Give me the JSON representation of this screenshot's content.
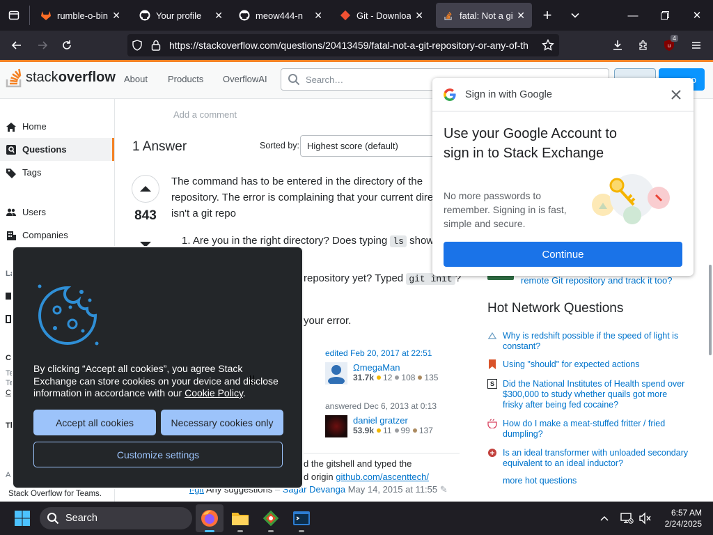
{
  "browser": {
    "tabs": [
      {
        "label": "rumble-o-bin · G",
        "icon": "gitlab-icon"
      },
      {
        "label": "Your profile",
        "icon": "github-icon"
      },
      {
        "label": "meow444-n",
        "icon": "github-icon"
      },
      {
        "label": "Git - Downloadin",
        "icon": "git-icon"
      },
      {
        "label": "fatal: Not a git re",
        "icon": "stackoverflow-icon",
        "active": true
      }
    ],
    "url": "https://stackoverflow.com/questions/20413459/fatal-not-a-git-repository-or-any-of-th",
    "extension_badge": "4"
  },
  "so_header": {
    "logo_prefix": "stack",
    "logo_bold": "overflow",
    "nav": [
      "About",
      "Products",
      "OverflowAI"
    ],
    "search_placeholder": "Search…",
    "signup_label": "p"
  },
  "sidebar": {
    "items": [
      {
        "label": "Home",
        "icon": "home-icon"
      },
      {
        "label": "Questions",
        "icon": "questions-icon",
        "selected": true
      },
      {
        "label": "Tags",
        "icon": "tag-icon"
      },
      {
        "label": "Users",
        "icon": "users-icon"
      },
      {
        "label": "Companies",
        "icon": "companies-icon"
      }
    ],
    "partial_letters": [
      "La",
      "C",
      "Te",
      "Te",
      "C",
      "Th",
      "A"
    ],
    "footer": "Stack Overflow for Teams."
  },
  "main": {
    "add_comment": "Add a comment",
    "answers_count": "1 Answer",
    "sorted_by_label": "Sorted by:",
    "sort_value": "Highest score (default)",
    "vote_score": "843",
    "answer_line1": "The command has to be entered in the directory of the",
    "answer_line2": "repository. The error is complaining that your current dire",
    "answer_line3": "isn't a git repo",
    "list1_prefix": "1. Are you in the right directory? Does typing ",
    "list1_code": "ls",
    "list1_suffix": " show",
    "list2_prefix": "repository yet? Typed ",
    "list2_code": "git init",
    "list2_suffix": "?",
    "list3": "your error.",
    "edited": {
      "label": "edited Feb 20, 2017 at 22:51",
      "name": "ΩmegaMan",
      "rep": "31.7k",
      "gold": "12",
      "silver": "108",
      "bronze": "135"
    },
    "answered": {
      "label": "answered Dec 6, 2013 at 0:13",
      "name": "daniel gratzer",
      "rep": "53.9k",
      "gold": "11",
      "silver": "99",
      "bronze": "137"
    },
    "comment_l1": "d the gitshell and typed the",
    "comment_l2_prefix": "d origin ",
    "comment_link": "github.com/ascenttech/",
    "comment_l3_prefix": "Any suggestions",
    "comment_l3_tag": "i-git",
    "comment_user": "Sagar Devanga",
    "comment_date": "May 14, 2015 at 11:55"
  },
  "right": {
    "related_tail": "remote Git repository and track it too?",
    "hnq_title": "Hot Network Questions",
    "hnq": [
      {
        "text": "Why is redshift possible if the speed of light is constant?",
        "icon": "physics-icon"
      },
      {
        "text": "Using \"should\" for expected actions",
        "icon": "bookmark-icon"
      },
      {
        "text": "Did the National Institutes of Health spend over $300,000 to study whether quails got more frisky after being fed cocaine?",
        "icon": "skeptics-icon"
      },
      {
        "text": "How do I make a meat-stuffed fritter / fried dumpling?",
        "icon": "cooking-icon"
      },
      {
        "text": "Is an ideal transformer with unloaded secondary equivalent to an ideal inductor?",
        "icon": "electronics-icon"
      }
    ],
    "more_hot": "more hot questions"
  },
  "google_popup": {
    "header": "Sign in with Google",
    "title": "Use your Google Account to sign in to Stack Exchange",
    "body": "No more passwords to remember. Signing in is fast, simple and secure.",
    "continue_label": "Continue"
  },
  "cookie_banner": {
    "text": "By clicking “Accept all cookies”, you agree Stack Exchange can store cookies on your device and disclose information in accordance with our",
    "policy_link": "Cookie Policy",
    "accept_all": "Accept all cookies",
    "necessary": "Necessary cookies only",
    "customize": "Customize settings"
  },
  "taskbar": {
    "search_label": "Search",
    "time": "6:57 AM",
    "date": "2/24/2025"
  },
  "colors": {
    "so_orange": "#f48225",
    "so_blue": "#0a95ff",
    "link": "#0074cc",
    "google_blue": "#1a73e8",
    "cookie_btn": "#9cc3fa"
  }
}
